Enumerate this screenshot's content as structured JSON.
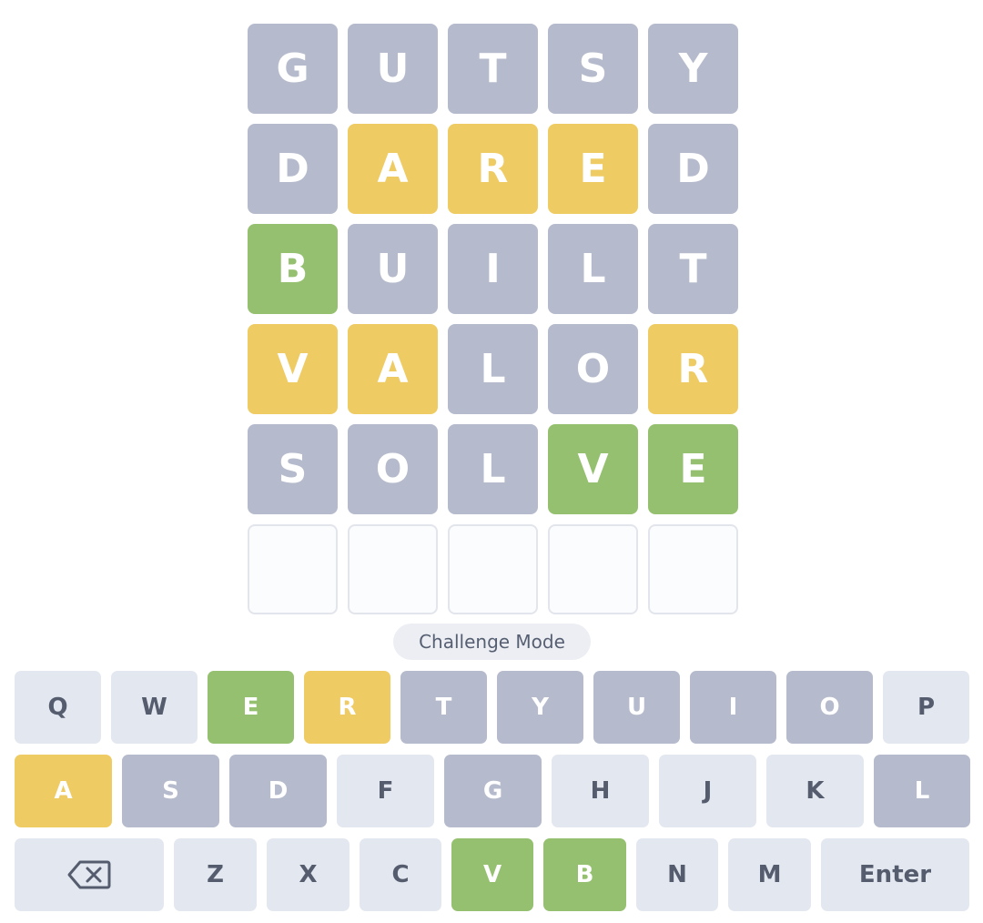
{
  "board": {
    "rows": [
      {
        "letters": [
          "G",
          "U",
          "T",
          "S",
          "Y"
        ],
        "states": [
          "absent",
          "absent",
          "absent",
          "absent",
          "absent"
        ]
      },
      {
        "letters": [
          "D",
          "A",
          "R",
          "E",
          "D"
        ],
        "states": [
          "absent",
          "present",
          "present",
          "present",
          "absent"
        ]
      },
      {
        "letters": [
          "B",
          "U",
          "I",
          "L",
          "T"
        ],
        "states": [
          "correct",
          "absent",
          "absent",
          "absent",
          "absent"
        ]
      },
      {
        "letters": [
          "V",
          "A",
          "L",
          "O",
          "R"
        ],
        "states": [
          "present",
          "present",
          "absent",
          "absent",
          "present"
        ]
      },
      {
        "letters": [
          "S",
          "O",
          "L",
          "V",
          "E"
        ],
        "states": [
          "absent",
          "absent",
          "absent",
          "correct",
          "correct"
        ]
      },
      {
        "letters": [
          "",
          "",
          "",
          "",
          ""
        ],
        "states": [
          "empty",
          "empty",
          "empty",
          "empty",
          "empty"
        ]
      }
    ]
  },
  "mode_label": "Challenge Mode",
  "keyboard": {
    "rows": [
      [
        {
          "label": "Q",
          "state": "unused"
        },
        {
          "label": "W",
          "state": "unused"
        },
        {
          "label": "E",
          "state": "correct"
        },
        {
          "label": "R",
          "state": "present"
        },
        {
          "label": "T",
          "state": "absent"
        },
        {
          "label": "Y",
          "state": "absent"
        },
        {
          "label": "U",
          "state": "absent"
        },
        {
          "label": "I",
          "state": "absent"
        },
        {
          "label": "O",
          "state": "absent"
        },
        {
          "label": "P",
          "state": "unused"
        }
      ],
      [
        {
          "label": "A",
          "state": "present"
        },
        {
          "label": "S",
          "state": "absent"
        },
        {
          "label": "D",
          "state": "absent"
        },
        {
          "label": "F",
          "state": "unused"
        },
        {
          "label": "G",
          "state": "absent"
        },
        {
          "label": "H",
          "state": "unused"
        },
        {
          "label": "J",
          "state": "unused"
        },
        {
          "label": "K",
          "state": "unused"
        },
        {
          "label": "L",
          "state": "absent"
        }
      ],
      [
        {
          "label": "",
          "icon": "backspace-icon",
          "state": "unused"
        },
        {
          "label": "Z",
          "state": "unused"
        },
        {
          "label": "X",
          "state": "unused"
        },
        {
          "label": "C",
          "state": "unused"
        },
        {
          "label": "V",
          "state": "correct"
        },
        {
          "label": "B",
          "state": "correct"
        },
        {
          "label": "N",
          "state": "unused"
        },
        {
          "label": "M",
          "state": "unused"
        },
        {
          "label": "Enter",
          "state": "unused"
        }
      ]
    ]
  }
}
